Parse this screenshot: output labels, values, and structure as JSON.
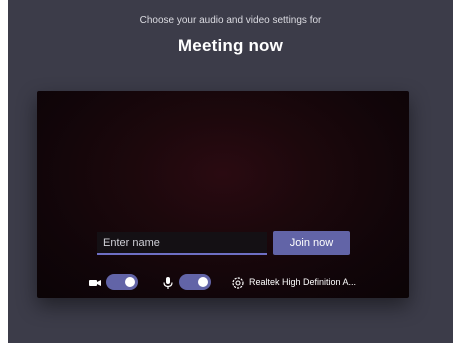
{
  "header": {
    "subtitle": "Choose your audio and video settings for",
    "title": "Meeting now"
  },
  "prejoin": {
    "name_placeholder": "Enter name",
    "name_value": "",
    "join_label": "Join now"
  },
  "controls": {
    "camera_icon": "video-camera-icon",
    "camera_on": true,
    "mic_icon": "microphone-icon",
    "mic_on": true,
    "device_icon": "gear-icon",
    "device_label": "Realtek High Definition A..."
  },
  "colors": {
    "background": "#3c3c49",
    "accent": "#6264a7",
    "preview": "#110509"
  }
}
